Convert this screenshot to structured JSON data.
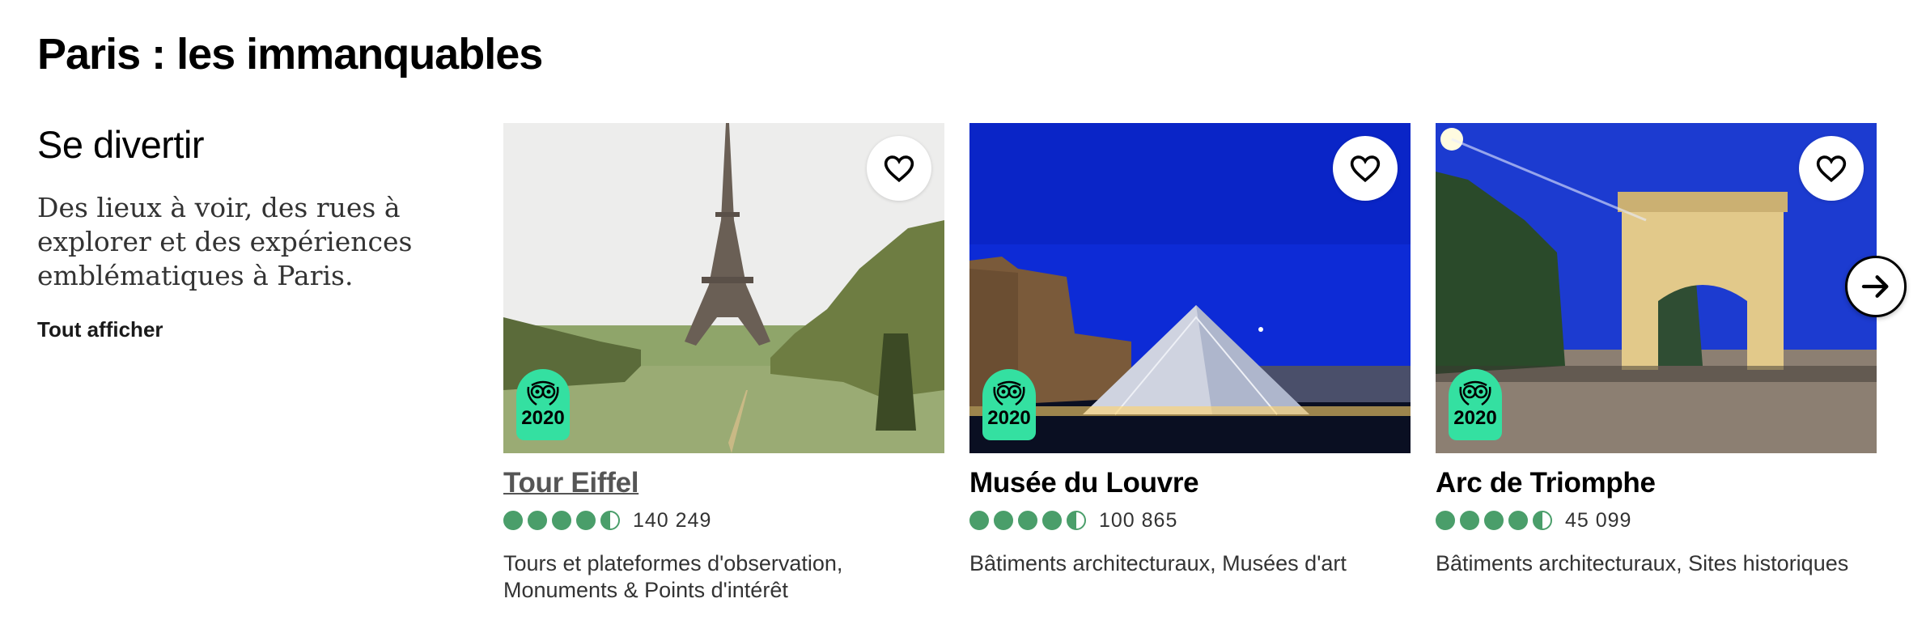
{
  "page": {
    "title": "Paris : les immanquables"
  },
  "section": {
    "heading": "Se divertir",
    "description": "Des lieux à voir, des rues à explorer et des expériences emblématiques à Paris.",
    "see_all": "Tout afficher"
  },
  "cards": [
    {
      "name": "Tour Eiffel",
      "badge_year": "2020",
      "rating": 4.5,
      "reviews": "140 249",
      "categories": "Tours et plateformes d'observation, Monuments & Points d'intérêt",
      "image_icon": "eiffel-tower-photo"
    },
    {
      "name": "Musée du Louvre",
      "badge_year": "2020",
      "rating": 4.5,
      "reviews": "100 865",
      "categories": "Bâtiments architecturaux, Musées d'art",
      "image_icon": "louvre-pyramid-photo"
    },
    {
      "name": "Arc de Triomphe",
      "badge_year": "2020",
      "rating": 4.5,
      "reviews": "45 099",
      "categories": "Bâtiments architecturaux, Sites historiques",
      "image_icon": "arc-de-triomphe-photo"
    }
  ],
  "colors": {
    "badge": "#34e0a1",
    "bubble": "#4a9e6a"
  },
  "icons": {
    "heart": "heart-icon",
    "next": "arrow-right-icon",
    "owl": "tripadvisor-owl-icon"
  }
}
